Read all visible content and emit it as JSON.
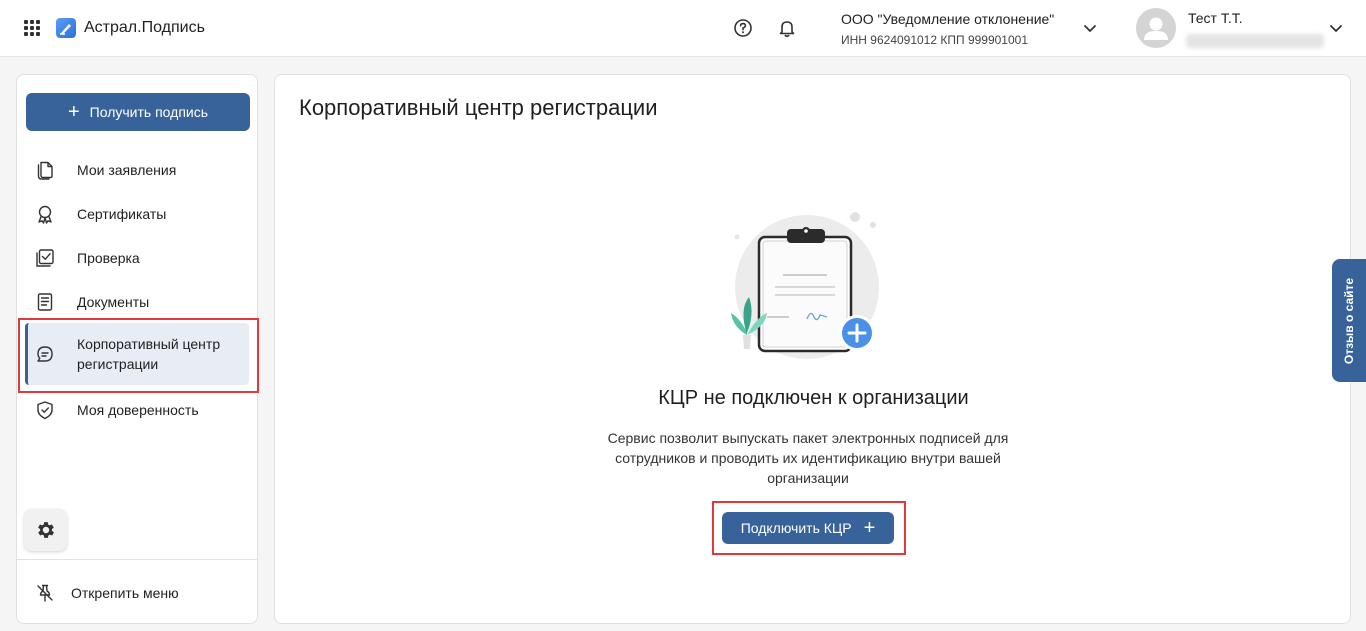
{
  "header": {
    "app_title": "Астрал.Подпись",
    "org_name": "ООО \"Уведомление отклонение\"",
    "org_requisites": "ИНН 9624091012   КПП 999901001",
    "user_name": "Тест Т.Т."
  },
  "sidebar": {
    "get_signature_label": "Получить подпись",
    "items": [
      {
        "label": "Мои заявления",
        "icon": "documents-icon"
      },
      {
        "label": "Сертификаты",
        "icon": "award-icon"
      },
      {
        "label": "Проверка",
        "icon": "check-square-icon"
      },
      {
        "label": "Документы",
        "icon": "document-icon"
      },
      {
        "label": "Корпоративный центр регистрации",
        "icon": "chat-icon",
        "active": true
      },
      {
        "label": "Моя доверенность",
        "icon": "shield-check-icon"
      }
    ],
    "unpin_label": "Открепить меню"
  },
  "main": {
    "page_title": "Корпоративный центр регистрации",
    "empty_title": "КЦР не подключен к организации",
    "empty_description": "Сервис позволит выпускать пакет электронных подписей для сотрудников и проводить их идентификацию внутри вашей организации",
    "connect_label": "Подключить КЦР"
  },
  "feedback_label": "Отзыв о сайте",
  "colors": {
    "accent": "#38639a",
    "highlight": "#e0393e",
    "active_bg": "#e8edf5"
  }
}
